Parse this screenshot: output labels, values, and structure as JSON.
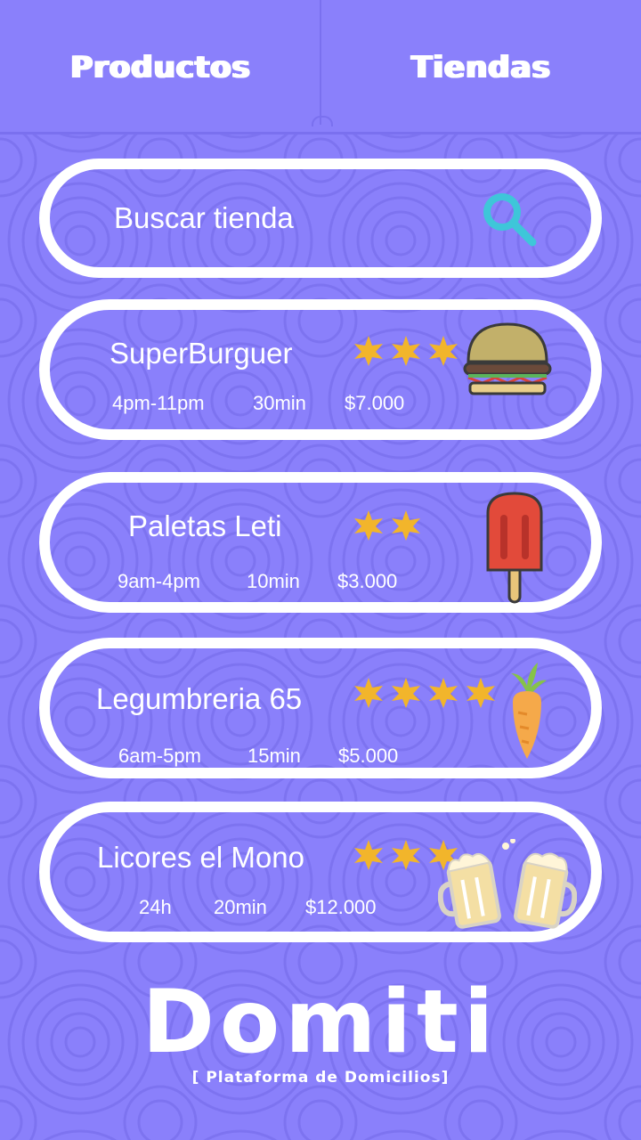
{
  "tabs": {
    "products": "Productos",
    "stores": "Tiendas"
  },
  "search": {
    "placeholder": "Buscar tienda"
  },
  "stores": [
    {
      "name": "SuperBurguer",
      "rating": 3,
      "hours": "4pm-11pm",
      "time": "30min",
      "price": "$7.000",
      "icon": "burger-icon"
    },
    {
      "name": "Paletas Leti",
      "rating": 2,
      "hours": "9am-4pm",
      "time": "10min",
      "price": "$3.000",
      "icon": "popsicle-icon"
    },
    {
      "name": "Legumbreria 65",
      "rating": 4,
      "hours": "6am-5pm",
      "time": "15min",
      "price": "$5.000",
      "icon": "carrot-icon"
    },
    {
      "name": "Licores el Mono",
      "rating": 3,
      "hours": "24h",
      "time": "20min",
      "price": "$12.000",
      "icon": "beer-mugs-icon"
    }
  ],
  "brand": {
    "logo": "Domiti",
    "tagline": "[ Plataforma de Domicilios]"
  },
  "colors": {
    "background": "#8a80fb",
    "star": "#f2b52b",
    "search_icon": "#3ec6d9"
  }
}
